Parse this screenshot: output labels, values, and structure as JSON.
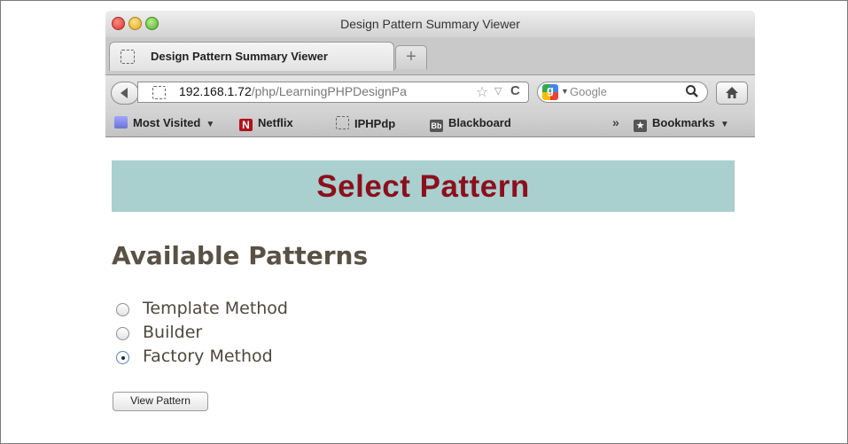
{
  "browser": {
    "window_title": "Design Pattern Summary Viewer",
    "tab_label": "Design Pattern Summary Viewer",
    "new_tab_label": "+",
    "url_host": "192.168.1.72",
    "url_path": "/php/LearningPHPDesignPa",
    "search_engine": "Google",
    "bookmarks": [
      {
        "label": "Most Visited",
        "icon": "folder-icon",
        "has_menu": true
      },
      {
        "label": "Netflix",
        "icon": "netflix-icon"
      },
      {
        "label": "IPHPdp",
        "icon": "page-icon"
      },
      {
        "label": "Blackboard",
        "icon": "blackboard-icon"
      }
    ],
    "bookmarks_menu": "Bookmarks"
  },
  "page": {
    "banner_title": "Select Pattern",
    "section_heading": "Available Patterns",
    "options": [
      {
        "label": "Template Method",
        "selected": false
      },
      {
        "label": "Builder",
        "selected": false
      },
      {
        "label": "Factory Method",
        "selected": true
      }
    ],
    "submit_label": "View Pattern"
  },
  "colors": {
    "banner_bg": "#a9cfcf",
    "banner_text": "#8c0f1c",
    "heading_text": "#5a5145"
  }
}
